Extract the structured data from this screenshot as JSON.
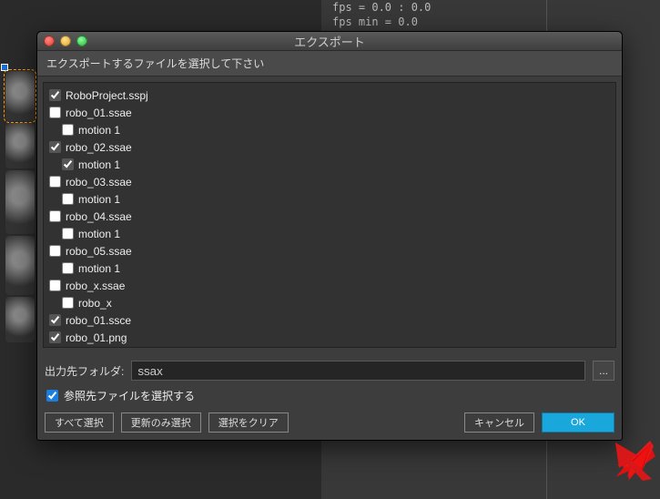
{
  "bg": {
    "fps_line1": "fps = 0.0 : 0.0",
    "fps_line2": "fps min = 0.0"
  },
  "dialog": {
    "title": "エクスポート",
    "instruction": "エクスポートするファイルを選択して下さい",
    "files": [
      {
        "label": "RoboProject.sspj",
        "checked": true,
        "indent": 0
      },
      {
        "label": "robo_01.ssae",
        "checked": false,
        "indent": 0
      },
      {
        "label": "motion 1",
        "checked": false,
        "indent": 1
      },
      {
        "label": "robo_02.ssae",
        "checked": true,
        "indent": 0
      },
      {
        "label": "motion 1",
        "checked": true,
        "indent": 1
      },
      {
        "label": "robo_03.ssae",
        "checked": false,
        "indent": 0
      },
      {
        "label": "motion 1",
        "checked": false,
        "indent": 1
      },
      {
        "label": "robo_04.ssae",
        "checked": false,
        "indent": 0
      },
      {
        "label": "motion 1",
        "checked": false,
        "indent": 1
      },
      {
        "label": "robo_05.ssae",
        "checked": false,
        "indent": 0
      },
      {
        "label": "motion 1",
        "checked": false,
        "indent": 1
      },
      {
        "label": "robo_x.ssae",
        "checked": false,
        "indent": 0
      },
      {
        "label": "robo_x",
        "checked": false,
        "indent": 1
      },
      {
        "label": "robo_01.ssce",
        "checked": true,
        "indent": 0
      },
      {
        "label": "robo_01.png",
        "checked": true,
        "indent": 0
      }
    ],
    "output_folder_label": "出力先フォルダ:",
    "output_folder_value": "ssax",
    "browse_label": "...",
    "ref_checkbox_label": "参照先ファイルを選択する",
    "ref_checkbox_checked": true,
    "buttons": {
      "select_all": "すべて選択",
      "select_updated": "更新のみ選択",
      "clear": "選択をクリア",
      "cancel": "キャンセル",
      "ok": "OK"
    }
  }
}
